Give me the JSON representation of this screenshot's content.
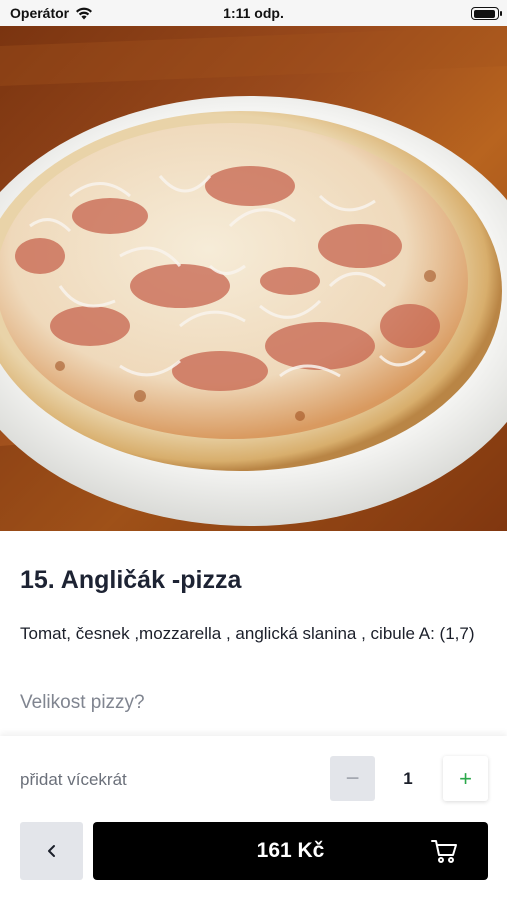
{
  "status_bar": {
    "carrier": "Operátor",
    "time": "1:11 odp.",
    "icons": [
      "wifi-icon",
      "battery-icon"
    ]
  },
  "product": {
    "image": "pizza-photo",
    "title": "15. Angličák -pizza",
    "description": "Tomat, česnek ,mozzarella , anglická slanina , cibule A: (1,7)",
    "size_question": "Velikost pizzy?"
  },
  "quantity": {
    "label": "přidat vícekrát",
    "minus": "−",
    "value": "1",
    "plus": "+"
  },
  "actions": {
    "back_icon": "chevron-left-icon",
    "price": "161 Kč",
    "cart_icon": "cart-icon"
  },
  "colors": {
    "primary": "#000000",
    "plus_accent": "#2aa84a",
    "muted_button": "#e3e5ea"
  }
}
